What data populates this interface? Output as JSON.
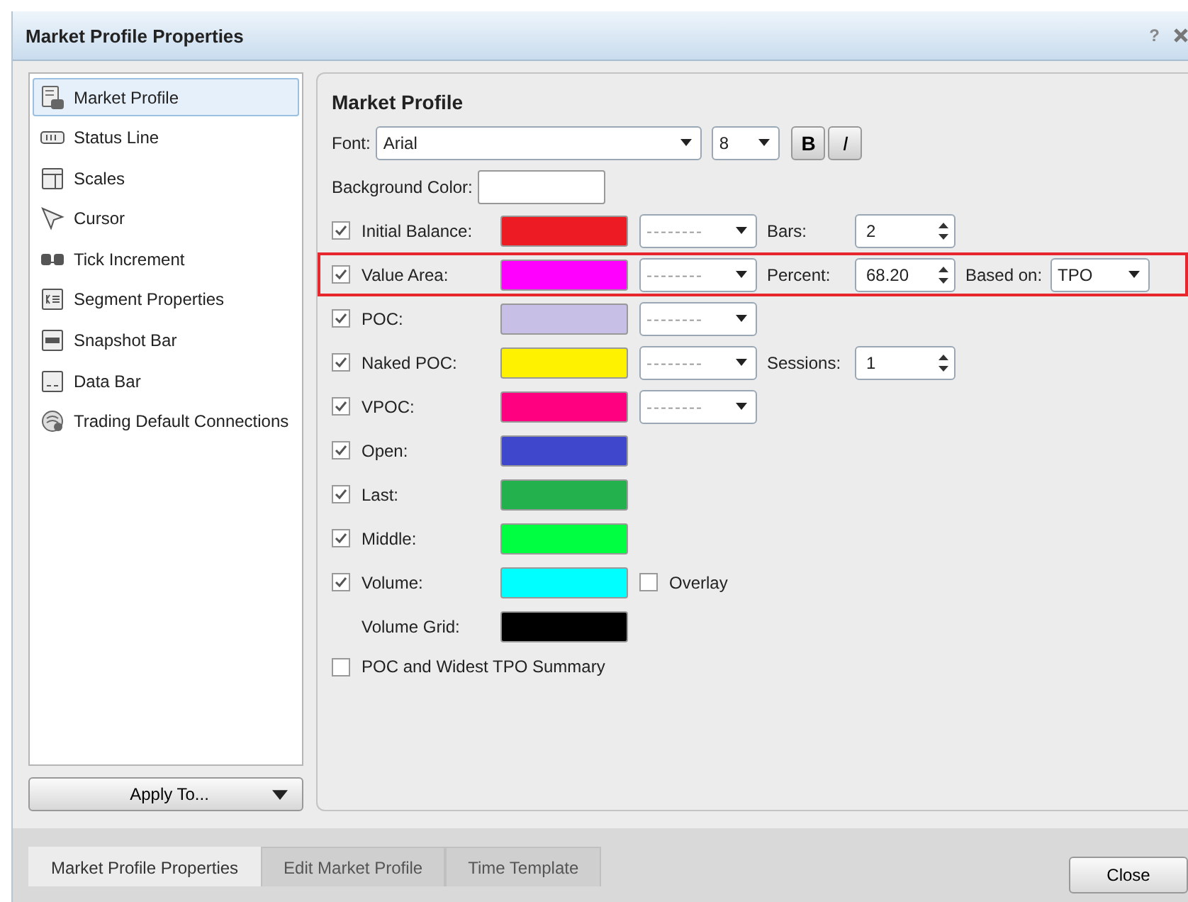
{
  "window": {
    "title": "Market Profile Properties",
    "help": "?"
  },
  "sidebar": {
    "items": [
      {
        "label": "Market Profile",
        "selected": true
      },
      {
        "label": "Status Line",
        "selected": false
      },
      {
        "label": "Scales",
        "selected": false
      },
      {
        "label": "Cursor",
        "selected": false
      },
      {
        "label": "Tick Increment",
        "selected": false
      },
      {
        "label": "Segment Properties",
        "selected": false
      },
      {
        "label": "Snapshot Bar",
        "selected": false
      },
      {
        "label": "Data Bar",
        "selected": false
      },
      {
        "label": "Trading Default Connections",
        "selected": false
      }
    ],
    "apply_button": "Apply To..."
  },
  "panel": {
    "heading": "Market Profile",
    "font": {
      "label": "Font:",
      "family": "Arial",
      "size": "8",
      "bold_button": "B",
      "italic_button": "I"
    },
    "background": {
      "label": "Background Color:",
      "color": "#ffffff"
    },
    "rows": [
      {
        "kind": "check",
        "label": "Initial Balance:",
        "checked": true,
        "color": "#ed1c24",
        "line_style": "--------",
        "highlighted": false,
        "extras": [
          {
            "kind": "spinner",
            "label": "Bars:",
            "value": "2"
          }
        ]
      },
      {
        "kind": "check",
        "label": "Value Area:",
        "checked": true,
        "color": "#ff00ff",
        "line_style": "--------",
        "highlighted": true,
        "extras": [
          {
            "kind": "spinner",
            "label": "Percent:",
            "value": "68.20"
          },
          {
            "kind": "dropdown",
            "label": "Based on:",
            "value": "TPO"
          }
        ]
      },
      {
        "kind": "check",
        "label": "POC:",
        "checked": true,
        "color": "#c8bfe7",
        "line_style": "--------",
        "highlighted": false
      },
      {
        "kind": "check",
        "label": "Naked POC:",
        "checked": true,
        "color": "#fff200",
        "line_style": "--------",
        "highlighted": false,
        "extras": [
          {
            "kind": "spinner",
            "label": "Sessions:",
            "value": "1"
          }
        ]
      },
      {
        "kind": "check",
        "label": "VPOC:",
        "checked": true,
        "color": "#ff0080",
        "line_style": "--------",
        "highlighted": false
      },
      {
        "kind": "check",
        "label": "Open:",
        "checked": true,
        "color": "#3f48cc",
        "highlighted": false
      },
      {
        "kind": "check",
        "label": "Last:",
        "checked": true,
        "color": "#22b14c",
        "highlighted": false
      },
      {
        "kind": "check",
        "label": "Middle:",
        "checked": true,
        "color": "#00ff40",
        "highlighted": false
      },
      {
        "kind": "check",
        "label": "Volume:",
        "checked": true,
        "color": "#00ffff",
        "highlighted": false,
        "extras": [
          {
            "kind": "checkbox",
            "label": "Overlay",
            "checked": false
          }
        ]
      },
      {
        "kind": "plain",
        "label": "Volume Grid:",
        "color": "#000000",
        "highlighted": false
      }
    ],
    "summary": {
      "label": "POC and Widest TPO Summary",
      "checked": false
    }
  },
  "tabs": [
    {
      "label": "Market Profile Properties",
      "selected": true
    },
    {
      "label": "Edit Market Profile",
      "selected": false
    },
    {
      "label": "Time Template",
      "selected": false
    }
  ],
  "close_button": "Close"
}
